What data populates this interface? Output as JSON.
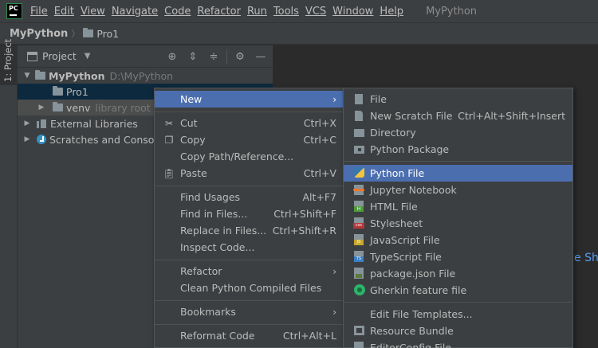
{
  "menubar": {
    "logo": "PC",
    "items": [
      "File",
      "Edit",
      "View",
      "Navigate",
      "Code",
      "Refactor",
      "Run",
      "Tools",
      "VCS",
      "Window",
      "Help"
    ],
    "window_title": "MyPython"
  },
  "breadcrumb": {
    "root": "MyPython",
    "current": "Pro1"
  },
  "left_stripe": {
    "label": "1: Project"
  },
  "project_panel": {
    "title": "Project",
    "tree": {
      "root_name": "MyPython",
      "root_path": "D:\\MyPython",
      "pro1": "Pro1",
      "venv": "venv",
      "venv_hint": "library root",
      "external_libraries": "External Libraries",
      "scratches": "Scratches and Consoles"
    }
  },
  "editor": {
    "hint_fragment": "e Sh"
  },
  "context_menu": {
    "new": "New",
    "cut": "Cut",
    "cut_shortcut": "Ctrl+X",
    "copy": "Copy",
    "copy_shortcut": "Ctrl+C",
    "copy_path": "Copy Path/Reference...",
    "paste": "Paste",
    "paste_shortcut": "Ctrl+V",
    "find_usages": "Find Usages",
    "find_usages_shortcut": "Alt+F7",
    "find_in_files": "Find in Files...",
    "find_in_files_shortcut": "Ctrl+Shift+F",
    "replace_in_files": "Replace in Files...",
    "replace_in_files_shortcut": "Ctrl+Shift+R",
    "inspect_code": "Inspect Code...",
    "refactor": "Refactor",
    "clean_compiled": "Clean Python Compiled Files",
    "bookmarks": "Bookmarks",
    "reformat_code": "Reformat Code",
    "reformat_code_shortcut": "Ctrl+Alt+L"
  },
  "new_submenu": {
    "file": "File",
    "new_scratch": "New Scratch File",
    "new_scratch_shortcut": "Ctrl+Alt+Shift+Insert",
    "directory": "Directory",
    "python_package": "Python Package",
    "python_file": "Python File",
    "jupyter": "Jupyter Notebook",
    "html": "HTML File",
    "stylesheet": "Stylesheet",
    "javascript": "JavaScript File",
    "typescript": "TypeScript File",
    "package_json": "package.json File",
    "gherkin": "Gherkin feature file",
    "edit_templates": "Edit File Templates...",
    "resource_bundle": "Resource Bundle",
    "editorconfig": "EditorConfig File"
  },
  "colors": {
    "selection": "#4b6eaf",
    "panel": "#3c3f41",
    "editor": "#2b2b2b",
    "tree_selection": "#0d293e"
  }
}
